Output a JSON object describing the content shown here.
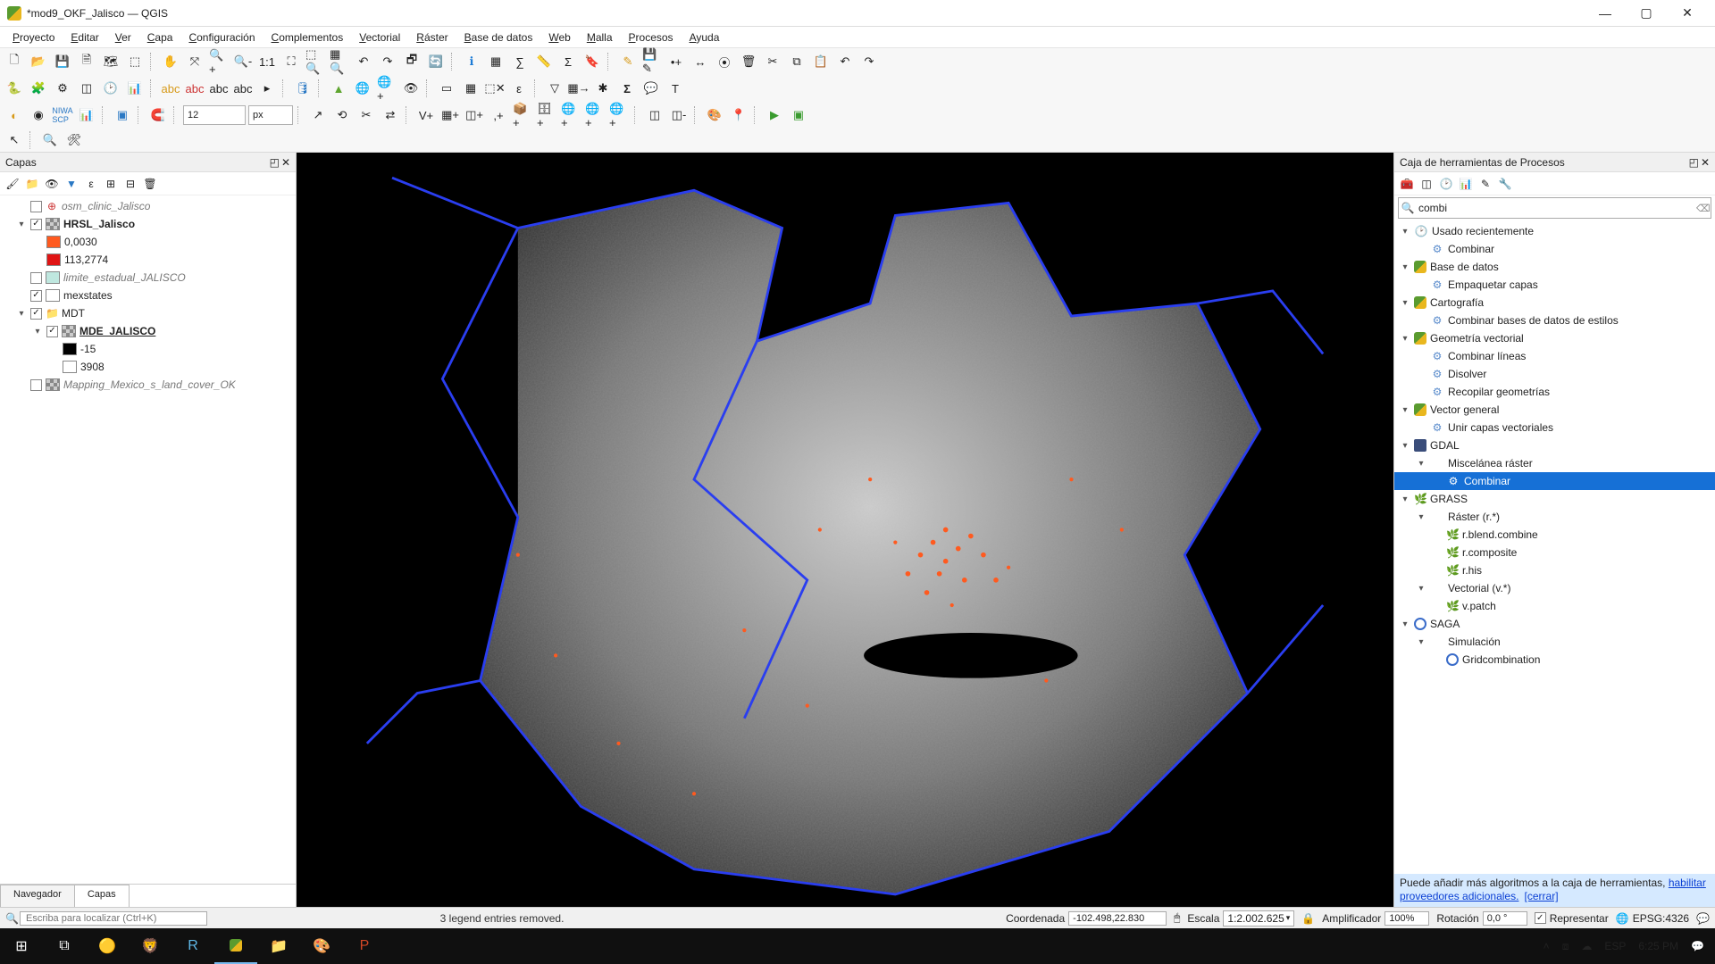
{
  "window": {
    "title": "*mod9_OKF_Jalisco — QGIS"
  },
  "menu": [
    "Proyecto",
    "Editar",
    "Ver",
    "Capa",
    "Configuración",
    "Complementos",
    "Vectorial",
    "Ráster",
    "Base de datos",
    "Web",
    "Malla",
    "Procesos",
    "Ayuda"
  ],
  "toolbar": {
    "spin_value": "12",
    "spin_unit": "px"
  },
  "layers_panel": {
    "title": "Capas",
    "tabs": {
      "browser": "Navegador",
      "layers": "Capas"
    },
    "items": [
      {
        "indent": 1,
        "expander": "",
        "checked": false,
        "icon": "point-red",
        "label": "osm_clinic_Jalisco",
        "style": "ital"
      },
      {
        "indent": 1,
        "expander": "▾",
        "checked": true,
        "icon": "raster",
        "label": "HRSL_Jalisco",
        "style": "bold"
      },
      {
        "indent": 2,
        "expander": "",
        "swatch": "#ff5a1f",
        "label": "0,0030"
      },
      {
        "indent": 2,
        "expander": "",
        "swatch": "#e01414",
        "label": "113,2774"
      },
      {
        "indent": 1,
        "expander": "",
        "checked": false,
        "swatch": "#bfe7df",
        "label": "limite_estadual_JALISCO",
        "style": "ital"
      },
      {
        "indent": 1,
        "expander": "",
        "checked": true,
        "swatch": "#ffffff",
        "label": "mexstates"
      },
      {
        "indent": 1,
        "expander": "▾",
        "checked": true,
        "icon": "group",
        "label": "MDT"
      },
      {
        "indent": 2,
        "expander": "▾",
        "checked": true,
        "icon": "raster",
        "label": "MDE_JALISCO",
        "style": "bold underline"
      },
      {
        "indent": 3,
        "expander": "",
        "swatch": "#000000",
        "label": "-15"
      },
      {
        "indent": 3,
        "expander": "",
        "swatch": "#ffffff",
        "label": "3908"
      },
      {
        "indent": 1,
        "expander": "",
        "checked": false,
        "icon": "raster",
        "label": "Mapping_Mexico_s_land_cover_OK",
        "style": "ital"
      }
    ]
  },
  "processing_panel": {
    "title": "Caja de herramientas de Procesos",
    "search_value": "combi",
    "tree": [
      {
        "i": 0,
        "exp": "▾",
        "icon": "clock",
        "label": "Usado recientemente"
      },
      {
        "i": 1,
        "icon": "gear",
        "label": "Combinar"
      },
      {
        "i": 0,
        "exp": "▾",
        "icon": "q",
        "label": "Base de datos"
      },
      {
        "i": 1,
        "icon": "gear",
        "label": "Empaquetar capas"
      },
      {
        "i": 0,
        "exp": "▾",
        "icon": "q",
        "label": "Cartografía"
      },
      {
        "i": 1,
        "icon": "gear",
        "label": "Combinar bases de datos de estilos"
      },
      {
        "i": 0,
        "exp": "▾",
        "icon": "q",
        "label": "Geometría vectorial"
      },
      {
        "i": 1,
        "icon": "gear",
        "label": "Combinar líneas"
      },
      {
        "i": 1,
        "icon": "gear",
        "label": "Disolver"
      },
      {
        "i": 1,
        "icon": "gear",
        "label": "Recopilar geometrías"
      },
      {
        "i": 0,
        "exp": "▾",
        "icon": "q",
        "label": "Vector general"
      },
      {
        "i": 1,
        "icon": "gear",
        "label": "Unir capas vectoriales"
      },
      {
        "i": 0,
        "exp": "▾",
        "icon": "gdal",
        "label": "GDAL"
      },
      {
        "i": 1,
        "exp": "▾",
        "label": "Miscelánea ráster"
      },
      {
        "i": 2,
        "icon": "gear",
        "label": "Combinar",
        "selected": true
      },
      {
        "i": 0,
        "exp": "▾",
        "icon": "grass",
        "label": "GRASS"
      },
      {
        "i": 1,
        "exp": "▾",
        "label": "Ráster (r.*)"
      },
      {
        "i": 2,
        "icon": "grass",
        "label": "r.blend.combine"
      },
      {
        "i": 2,
        "icon": "grass",
        "label": "r.composite"
      },
      {
        "i": 2,
        "icon": "grass",
        "label": "r.his"
      },
      {
        "i": 1,
        "exp": "▾",
        "label": "Vectorial (v.*)"
      },
      {
        "i": 2,
        "icon": "grass",
        "label": "v.patch"
      },
      {
        "i": 0,
        "exp": "▾",
        "icon": "saga",
        "label": "SAGA",
        "dim": true
      },
      {
        "i": 1,
        "exp": "▾",
        "label": "Simulación",
        "dim": true
      },
      {
        "i": 2,
        "icon": "saga",
        "label": "Gridcombination",
        "dim": true
      }
    ],
    "hint": {
      "prefix": "Puede añadir más algoritmos a la caja de herramientas, ",
      "link1": "habilitar proveedores adicionales.",
      "link2": "[cerrar]"
    }
  },
  "statusbar": {
    "locator_placeholder": "Escriba para localizar (Ctrl+K)",
    "message": "3 legend entries removed.",
    "coord_label": "Coordenada",
    "coord_value": "-102.498,22.830",
    "scale_label": "Escala",
    "scale_value": "1:2.002.625",
    "lock": "🔒",
    "mag_label": "Amplificador",
    "mag_value": "100%",
    "rot_label": "Rotación",
    "rot_value": "0,0 °",
    "render_label": "Representar",
    "crs": "EPSG:4326"
  },
  "taskbar": {
    "lang": "ESP",
    "time": "6:25 PM"
  }
}
